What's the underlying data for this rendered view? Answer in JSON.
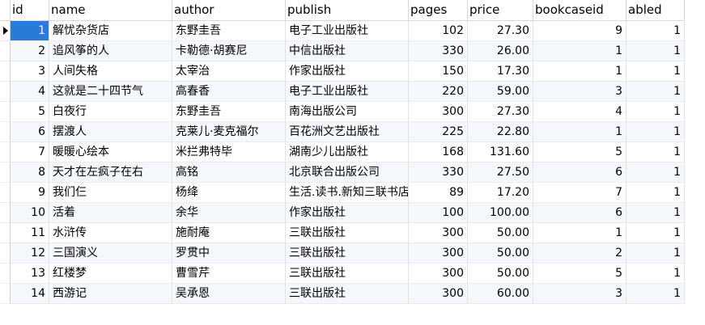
{
  "grid": {
    "columns": [
      "id",
      "name",
      "author",
      "publish",
      "pages",
      "price",
      "bookcaseid",
      "abled"
    ],
    "rows": [
      [
        "1",
        "解忧杂货店",
        "东野圭吾",
        "电子工业出版社",
        "102",
        "27.30",
        "9",
        "1"
      ],
      [
        "2",
        "追风筝的人",
        "卡勒德·胡赛尼",
        "中信出版社",
        "330",
        "26.00",
        "1",
        "1"
      ],
      [
        "3",
        "人间失格",
        "太宰治",
        "作家出版社",
        "150",
        "17.30",
        "1",
        "1"
      ],
      [
        "4",
        "这就是二十四节气",
        "高春香",
        "电子工业出版社",
        "220",
        "59.00",
        "3",
        "1"
      ],
      [
        "5",
        "白夜行",
        "东野圭吾",
        "南海出版公司",
        "300",
        "27.30",
        "4",
        "1"
      ],
      [
        "6",
        "摆渡人",
        "克莱儿·麦克福尔",
        "百花洲文艺出版社",
        "225",
        "22.80",
        "1",
        "1"
      ],
      [
        "7",
        "暖暖心绘本",
        "米拦弗特毕",
        "湖南少儿出版社",
        "168",
        "131.60",
        "5",
        "1"
      ],
      [
        "8",
        "天才在左疯子在右",
        "高铭",
        "北京联合出版公司",
        "330",
        "27.50",
        "6",
        "1"
      ],
      [
        "9",
        "我们仨",
        "杨绛",
        "生活.读书.新知三联书店",
        "89",
        "17.20",
        "7",
        "1"
      ],
      [
        "10",
        "活着",
        "余华",
        "作家出版社",
        "100",
        "100.00",
        "6",
        "1"
      ],
      [
        "11",
        "水浒传",
        "施耐庵",
        "三联出版社",
        "300",
        "50.00",
        "1",
        "1"
      ],
      [
        "12",
        "三国演义",
        "罗贯中",
        "三联出版社",
        "300",
        "50.00",
        "2",
        "1"
      ],
      [
        "13",
        "红楼梦",
        "曹雪芹",
        "三联出版社",
        "300",
        "50.00",
        "5",
        "1"
      ],
      [
        "14",
        "西游记",
        "吴承恩",
        "三联出版社",
        "300",
        "60.00",
        "3",
        "1"
      ]
    ],
    "selected_row_index": 0,
    "colors": {
      "selection": "#2a7ad8",
      "alt_row": "#f4f7fc",
      "grid_line": "#e3e3e3"
    },
    "icons": {
      "current_row_indicator": "right-triangle-icon"
    }
  }
}
